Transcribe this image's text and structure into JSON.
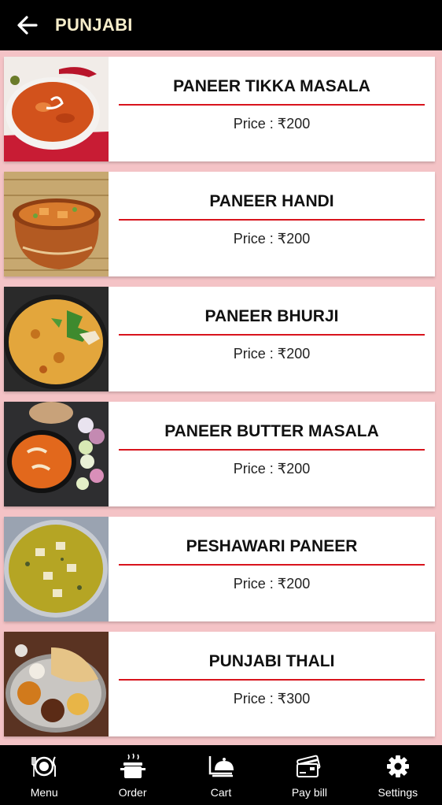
{
  "header": {
    "title": "PUNJABI",
    "back_icon": "arrow-left-icon"
  },
  "price_prefix": "Price : ",
  "items": [
    {
      "name": "PANEER TIKKA MASALA",
      "price": "Price : ₹200",
      "image": "paneer-tikka-masala-photo"
    },
    {
      "name": "PANEER HANDI",
      "price": "Price : ₹200",
      "image": "paneer-handi-photo"
    },
    {
      "name": "PANEER BHURJI",
      "price": "Price : ₹200",
      "image": "paneer-bhurji-photo"
    },
    {
      "name": "PANEER BUTTER MASALA",
      "price": "Price : ₹200",
      "image": "paneer-butter-masala-photo"
    },
    {
      "name": "PESHAWARI PANEER",
      "price": "Price : ₹200",
      "image": "peshawari-paneer-photo"
    },
    {
      "name": "PUNJABI THALI",
      "price": "Price : ₹300",
      "image": "punjabi-thali-photo"
    }
  ],
  "nav": [
    {
      "label": "Menu",
      "icon": "plate-cutlery-icon"
    },
    {
      "label": "Order",
      "icon": "cooking-pot-icon"
    },
    {
      "label": "Cart",
      "icon": "serving-cloche-icon"
    },
    {
      "label": "Pay bill",
      "icon": "cards-icon"
    },
    {
      "label": "Settings",
      "icon": "gear-icon"
    }
  ],
  "colors": {
    "header_bg": "#000000",
    "title": "#f7eecb",
    "accent_rule": "#d8141d",
    "page_bg": "#f4c3c6"
  }
}
